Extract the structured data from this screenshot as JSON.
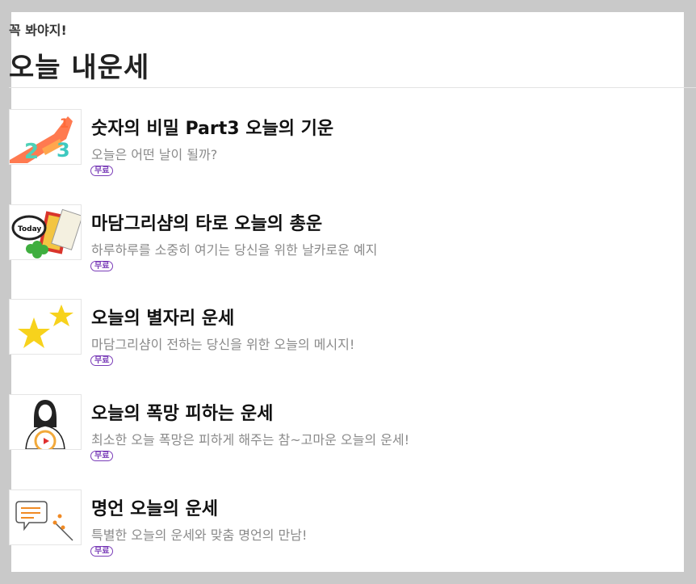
{
  "header": {
    "eyebrow": "꼭 봐야지!",
    "title": "오늘 내운세"
  },
  "items": [
    {
      "title": "숫자의 비밀 Part3 오늘의 기운",
      "description": "오늘은 어떤 날이 될까?",
      "badge": "무료",
      "thumbnail_icon": "numbers-123-icon"
    },
    {
      "title": "마담그리샴의 타로 오늘의 총운",
      "description": "하루하루를 소중히 여기는 당신을 위한 날카로운 예지",
      "badge": "무료",
      "thumbnail_icon": "today-tarot-clover-icon",
      "thumbnail_text": "Today"
    },
    {
      "title": "오늘의 별자리 운세",
      "description": "마담그리샴이 전하는 당신을 위한 오늘의 메시지!",
      "badge": "무료",
      "thumbnail_icon": "yellow-stars-icon"
    },
    {
      "title": "오늘의 폭망 피하는 운세",
      "description": "최소한 오늘 폭망은 피하게 해주는 참~고마운 오늘의 운세!",
      "badge": "무료",
      "thumbnail_icon": "woman-with-compass-icon"
    },
    {
      "title": "명언 오늘의 운세",
      "description": "특별한 오늘의 운세와 맞춤 명언의 만남!",
      "badge": "무료",
      "thumbnail_icon": "speech-bubble-pen-icon"
    }
  ],
  "colors": {
    "background": "#c9c9c9",
    "panel": "#ffffff",
    "badge": "#7a3db8",
    "title": "#111111",
    "description": "#8a8a8a"
  }
}
